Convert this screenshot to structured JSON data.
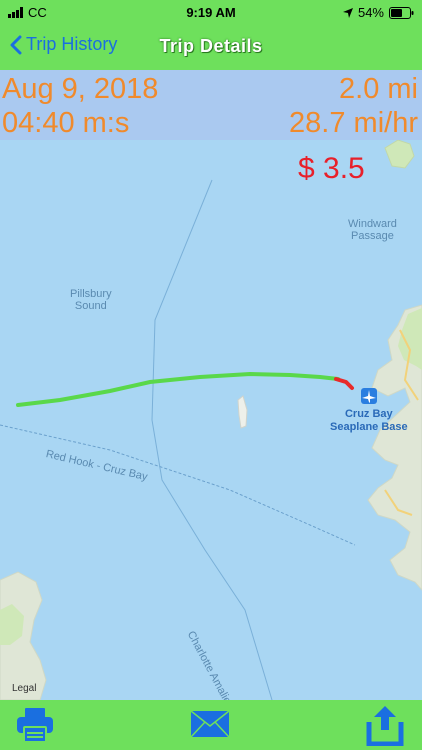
{
  "status_bar": {
    "carrier": "CC",
    "time": "9:19 AM",
    "battery": "54%"
  },
  "nav": {
    "back_label": "Trip History",
    "title": "Trip Details"
  },
  "trip": {
    "date": "Aug 9, 2018",
    "duration": "04:40 m:s",
    "distance": "2.0 mi",
    "speed": "28.7 mi/hr",
    "cost": "$ 3.5"
  },
  "map": {
    "labels": {
      "windward": "Windward\nPassage",
      "pillsbury": "Pillsbury\nSound",
      "red_hook": "Red Hook - Cruz Bay",
      "charlotte": "Charlotte Amalie - Tortola",
      "seaplane": "Cruz Bay\nSeaplane Base"
    },
    "legal": "Legal"
  },
  "colors": {
    "bar_green": "#6ee05c",
    "accent_orange": "#f08a2c",
    "cost_red": "#e8202a",
    "link_blue": "#1a6fe0"
  },
  "toolbar": {
    "print_icon": "printer-icon",
    "mail_icon": "mail-icon",
    "share_icon": "share-icon"
  }
}
